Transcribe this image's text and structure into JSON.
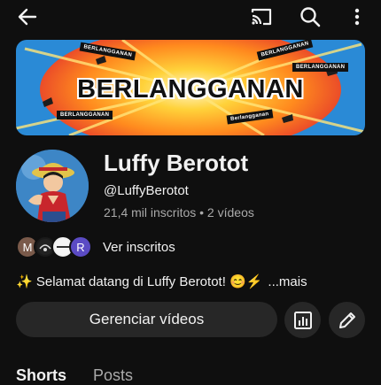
{
  "topbar": {
    "back_icon": "arrow-left-icon",
    "cast_icon": "cast-icon",
    "search_icon": "search-icon",
    "more_icon": "more-vert-icon"
  },
  "banner": {
    "title": "BERLANGGANAN",
    "tag_text": "BERLANGGANAN",
    "tag_small": "Berlangganan"
  },
  "channel": {
    "name": "Luffy Berotot",
    "handle": "@LuffyBerotot",
    "stats": "21,4 mil inscritos • 2 vídeos"
  },
  "subscribers": {
    "avatars": [
      "M",
      "",
      "",
      "R"
    ],
    "label": "Ver inscritos"
  },
  "description": {
    "text": "✨ Selamat datang di Luffy Berotot! 😊⚡",
    "more": "...mais"
  },
  "actions": {
    "manage_videos": "Gerenciar vídeos",
    "analytics_icon": "analytics-icon",
    "edit_icon": "edit-pencil-icon"
  },
  "tabs": [
    "Shorts",
    "Posts"
  ],
  "colors": {
    "background": "#0f0f0f",
    "button_bg": "#272727",
    "secondary_text": "#aaaaaa",
    "subscriber_r": "#5b4bc4"
  }
}
